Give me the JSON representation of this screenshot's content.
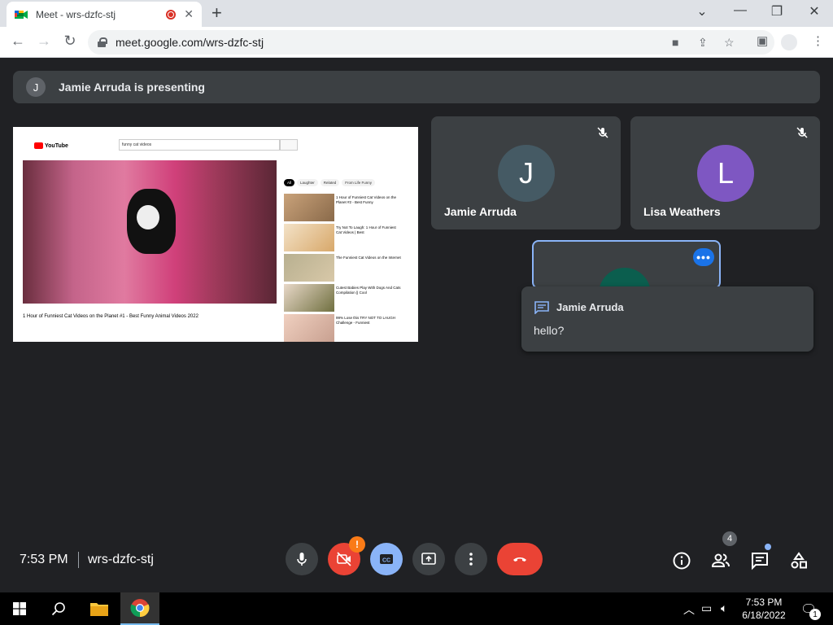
{
  "browser": {
    "tab_title": "Meet - wrs-dzfc-stj",
    "url": "meet.google.com/wrs-dzfc-stj"
  },
  "meet": {
    "presenting_initial": "J",
    "presenting_text": "Jamie Arruda is presenting",
    "participants": [
      {
        "initial": "J",
        "name": "Jamie Arruda",
        "color": "#455a64"
      },
      {
        "initial": "L",
        "name": "Lisa Weathers",
        "color": "#7e57c2"
      }
    ],
    "chat_toast": {
      "sender": "Jamie Arruda",
      "message": "hello?"
    },
    "time": "7:53 PM",
    "meeting_code": "wrs-dzfc-stj",
    "camera_warning": "!",
    "people_count": "4"
  },
  "shared_screen": {
    "search_query": "funny cat videos",
    "video_title": "1 Hour of Funniest Cat Videos on the Planet #1 - Best Funny Animal Videos 2022",
    "chips": [
      "All",
      "Laughter",
      "Related",
      "From Life Funny"
    ],
    "recommendations": [
      "1 Hour of Funniest Cat Videos on the Planet #2 - Best Funny",
      "Try Not To Laugh: 1 Hour of Funniest Cat Videos | Best",
      "The Funniest Cat Videos on the Internet",
      "Cutest Babies Play With Dogs And Cats Compilation || Cool",
      "99% Lose this TRY NOT TO LAUGH Challenge - Funniest"
    ]
  },
  "taskbar": {
    "time": "7:53 PM",
    "date": "6/18/2022",
    "notifications": "1"
  }
}
